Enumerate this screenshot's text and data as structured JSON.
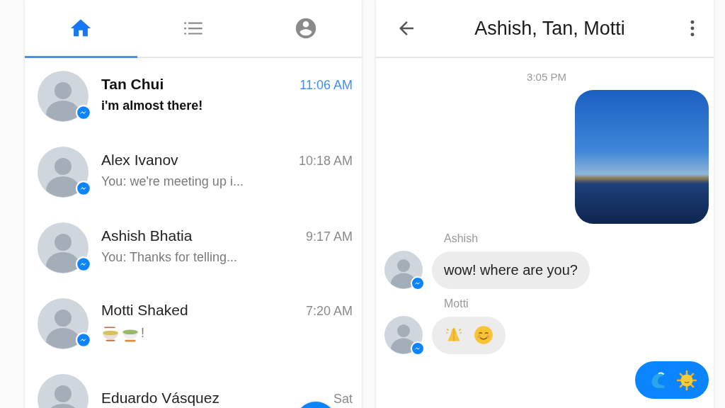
{
  "tabs": [
    {
      "kind": "home",
      "selected": true
    },
    {
      "kind": "list",
      "selected": false
    },
    {
      "kind": "profile",
      "selected": false
    }
  ],
  "conversations": [
    {
      "name": "Tan Chui",
      "preview": "i'm almost there!",
      "time": "11:06 AM",
      "unread": true
    },
    {
      "name": "Alex Ivanov",
      "preview": "You: we're meeting up i...",
      "time": "10:18 AM",
      "unread": false
    },
    {
      "name": "Ashish Bhatia",
      "preview": "You: Thanks for telling...",
      "time": "9:17 AM",
      "unread": false
    },
    {
      "name": "Motti Shaked",
      "preview_emoji": [
        {
          "kind": "noodles"
        },
        {
          "kind": "tea"
        }
      ],
      "preview": "!",
      "time": "7:20 AM",
      "unread": false
    },
    {
      "name": "Eduardo Vásquez",
      "time": "Sat",
      "unread": false
    }
  ],
  "chat": {
    "title": "Ashish, Tan, Motti",
    "timestamp": "3:05 PM",
    "messages": [
      {
        "kind": "photo",
        "outgoing": true
      },
      {
        "kind": "text",
        "outgoing": false,
        "sender": "Ashish",
        "text": "wow! where are you?"
      },
      {
        "kind": "emoji",
        "outgoing": false,
        "sender": "Motti",
        "emoji": [
          {
            "kind": "praying-hands"
          },
          {
            "kind": "smile"
          }
        ]
      },
      {
        "kind": "emoji",
        "outgoing": true,
        "emoji": [
          {
            "kind": "wave"
          },
          {
            "kind": "sun"
          }
        ]
      }
    ]
  }
}
